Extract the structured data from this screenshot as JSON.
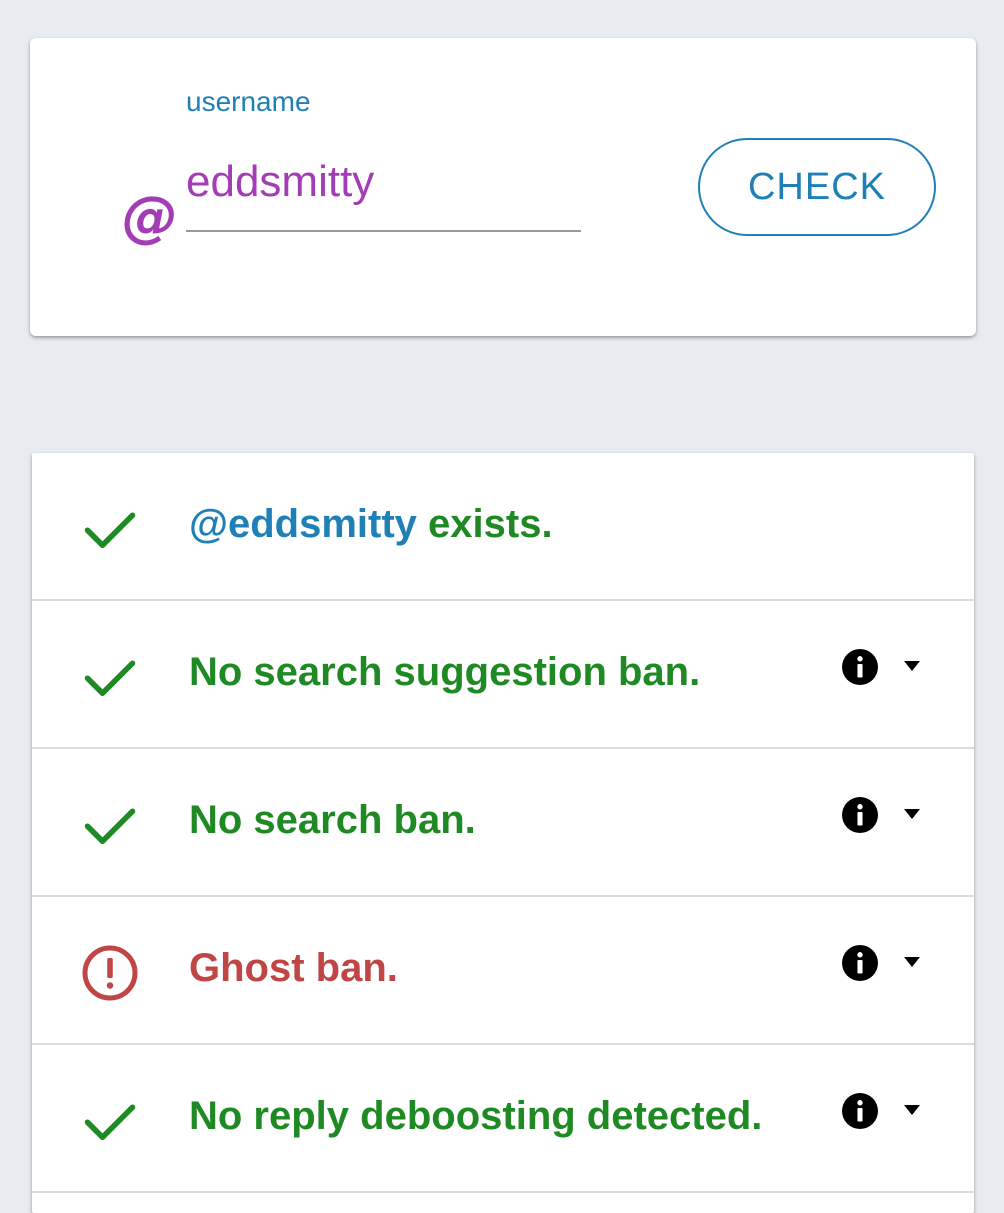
{
  "search": {
    "at_symbol": "@",
    "label": "username",
    "value": "eddsmitty",
    "button_label": "CHECK"
  },
  "results": [
    {
      "status": "ok",
      "handle": "@eddsmitty",
      "text": " exists.",
      "has_info": false
    },
    {
      "status": "ok",
      "text": "No search suggestion ban.",
      "has_info": true
    },
    {
      "status": "ok",
      "text": "No search ban.",
      "has_info": true
    },
    {
      "status": "bad",
      "text": "Ghost ban.",
      "has_info": true
    },
    {
      "status": "ok",
      "text": "No reply deboosting detected.",
      "has_info": true
    }
  ],
  "icons": {
    "ok": "check-icon",
    "bad": "alert-circle-icon",
    "info": "info-icon",
    "expand": "caret-down-icon"
  },
  "colors": {
    "background": "#e8ecf0",
    "accent_blue": "#1f80b8",
    "username_purple": "#a33db5",
    "ok_green": "#1f8a24",
    "bad_red": "#c04545"
  }
}
